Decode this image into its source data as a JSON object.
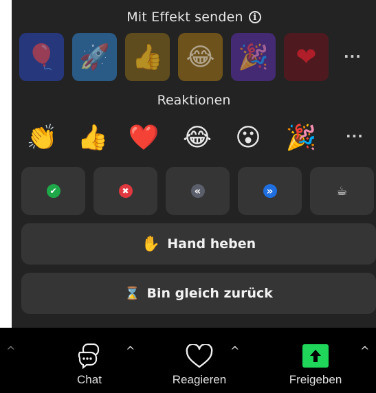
{
  "effects": {
    "title": "Mit Effekt senden",
    "info_icon": "info-icon",
    "items": [
      {
        "name": "balloon",
        "glyph": "🎈",
        "bg": "#2a3f8c"
      },
      {
        "name": "rocket",
        "glyph": "🚀",
        "bg": "#2e5e8c"
      },
      {
        "name": "thumbs-up",
        "glyph": "👍",
        "bg": "#6a5622"
      },
      {
        "name": "laughing",
        "glyph": "😂",
        "bg": "#7a5a1e"
      },
      {
        "name": "party",
        "glyph": "🎉",
        "bg": "#4a2f7a"
      },
      {
        "name": "heart",
        "glyph": "❤",
        "bg": "#5a1c22"
      }
    ],
    "more_label": "···"
  },
  "reactions": {
    "title": "Reaktionen",
    "items": [
      {
        "name": "clap",
        "glyph": "👏"
      },
      {
        "name": "thumbs-up",
        "glyph": "👍"
      },
      {
        "name": "heart",
        "glyph": "❤️"
      },
      {
        "name": "joy",
        "glyph": "😂"
      },
      {
        "name": "surprised",
        "glyph": "😮"
      },
      {
        "name": "party",
        "glyph": "🎉"
      }
    ],
    "more_label": "···"
  },
  "status_buttons": [
    {
      "name": "yes",
      "glyph": "✔",
      "color": "#1fa84a"
    },
    {
      "name": "no",
      "glyph": "✖",
      "color": "#e0383e"
    },
    {
      "name": "slow-down",
      "glyph": "«",
      "color": "#5a5f6b"
    },
    {
      "name": "speed-up",
      "glyph": "»",
      "color": "#1f6fe0"
    },
    {
      "name": "coffee",
      "glyph": "☕",
      "color": "transparent"
    }
  ],
  "hand": {
    "emoji": "✋",
    "label": "Hand heben"
  },
  "brb": {
    "emoji": "⌛",
    "label": "Bin gleich zurück"
  },
  "toolbar": {
    "chat": {
      "label": "Chat"
    },
    "react": {
      "label": "Reagieren"
    },
    "share": {
      "label": "Freigeben",
      "color": "#1fd65a"
    },
    "caret": "^"
  }
}
